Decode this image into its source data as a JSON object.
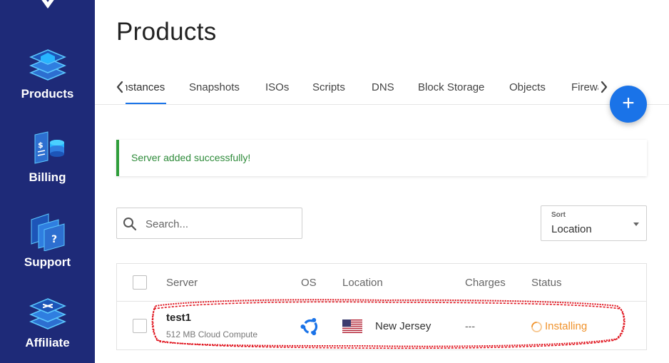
{
  "sidebar": {
    "items": [
      {
        "label": "Products",
        "icon": "products-icon"
      },
      {
        "label": "Billing",
        "icon": "billing-icon"
      },
      {
        "label": "Support",
        "icon": "support-icon"
      },
      {
        "label": "Affiliate",
        "icon": "affiliate-icon"
      }
    ]
  },
  "page": {
    "title": "Products"
  },
  "tabs": [
    {
      "label": "Instances",
      "active": true
    },
    {
      "label": "Snapshots"
    },
    {
      "label": "ISOs"
    },
    {
      "label": "Scripts"
    },
    {
      "label": "DNS"
    },
    {
      "label": "Block Storage"
    },
    {
      "label": "Objects"
    },
    {
      "label": "Firewall"
    }
  ],
  "fab": {
    "label": "+"
  },
  "alert": {
    "message": "Server added successfully!",
    "color": "#2e9d3a"
  },
  "search": {
    "placeholder": "Search...",
    "value": ""
  },
  "sort": {
    "label": "Sort",
    "value": "Location"
  },
  "table": {
    "columns": [
      "Server",
      "OS",
      "Location",
      "Charges",
      "Status"
    ],
    "rows": [
      {
        "name": "test1",
        "plan": "512 MB Cloud Compute",
        "os_icon": "ubuntu-icon",
        "flag_icon": "us-flag-icon",
        "location": "New Jersey",
        "charges": "---",
        "status": "Installing",
        "status_color": "#f0922b"
      }
    ]
  },
  "colors": {
    "sidebar": "#1e2a78",
    "accent": "#1a73e8",
    "annotation": "#e0141e"
  }
}
